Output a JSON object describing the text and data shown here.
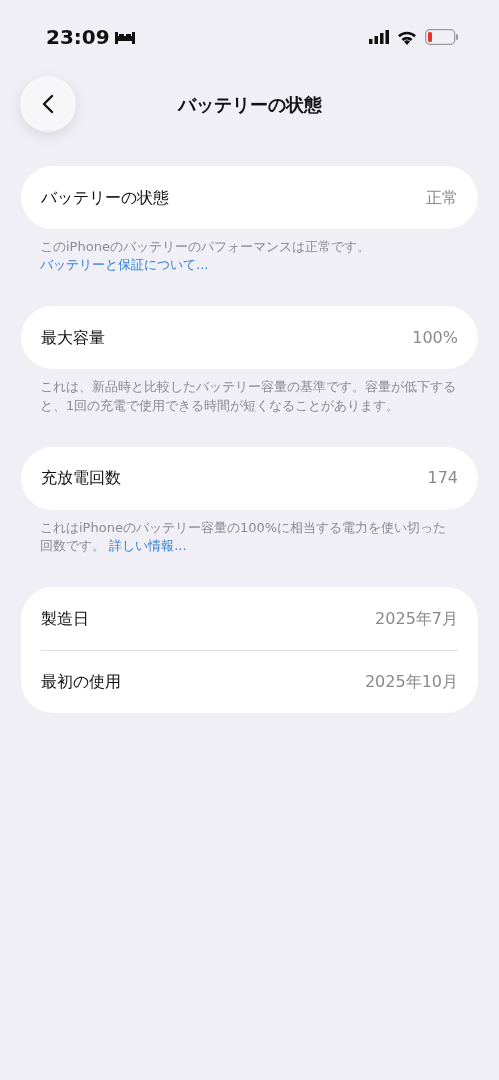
{
  "status_bar": {
    "time": "23:09"
  },
  "nav": {
    "title": "バッテリーの状態"
  },
  "sections": [
    {
      "rows": [
        {
          "label": "バッテリーの状態",
          "value": "正常"
        }
      ],
      "footer": {
        "text": "このiPhoneのバッテリーのパフォーマンスは正常です。",
        "link": "バッテリーと保証について..."
      }
    },
    {
      "rows": [
        {
          "label": "最大容量",
          "value": "100%"
        }
      ],
      "footer": {
        "text": "これは、新品時と比較したバッテリー容量の基準です。容量が低下すると、1回の充電で使用できる時間が短くなることがあります。"
      }
    },
    {
      "rows": [
        {
          "label": "充放電回数",
          "value": "174"
        }
      ],
      "footer": {
        "text": "これはiPhoneのバッテリー容量の100%に相当する電力を使い切った回数です。",
        "link": "詳しい情報..."
      }
    },
    {
      "rows": [
        {
          "label": "製造日",
          "value": "2025年7月"
        },
        {
          "label": "最初の使用",
          "value": "2025年10月"
        }
      ]
    }
  ]
}
